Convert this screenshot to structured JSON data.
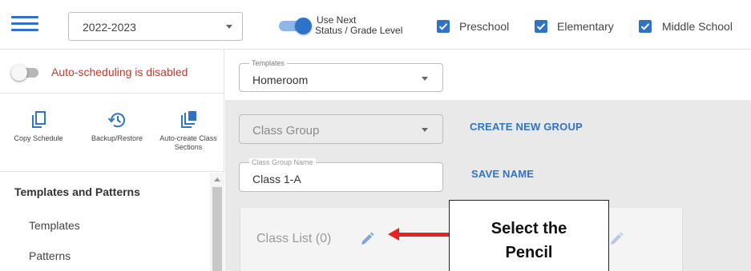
{
  "header": {
    "school_year": "2022-2023",
    "use_next_line1": "Use Next",
    "use_next_line2": "Status / Grade Level",
    "filters": [
      "Preschool",
      "Elementary",
      "Middle School"
    ]
  },
  "sidebar": {
    "auto_scheduling": "Auto-scheduling is disabled",
    "tools": [
      {
        "label": "Copy Schedule",
        "icon": "copy-icon"
      },
      {
        "label": "Backup/Restore",
        "icon": "history-icon"
      },
      {
        "label": "Auto-create Class Sections",
        "icon": "layers-icon"
      }
    ],
    "section_title": "Templates and Patterns",
    "items": [
      "Templates",
      "Patterns"
    ]
  },
  "main": {
    "templates_label": "Templates",
    "templates_value": "Homeroom",
    "class_group_placeholder": "Class Group",
    "create_group_label": "CREATE NEW GROUP",
    "class_group_name_label": "Class Group Name",
    "class_group_name_value": "Class 1-A",
    "save_name_label": "SAVE NAME",
    "class_list_title": "Class List (0)"
  },
  "annotation": {
    "line1": "Select the",
    "line2": "Pencil"
  },
  "colors": {
    "accent": "#2f73c9",
    "warning_text": "#c0392b",
    "annotation_arrow": "#e8231f"
  }
}
